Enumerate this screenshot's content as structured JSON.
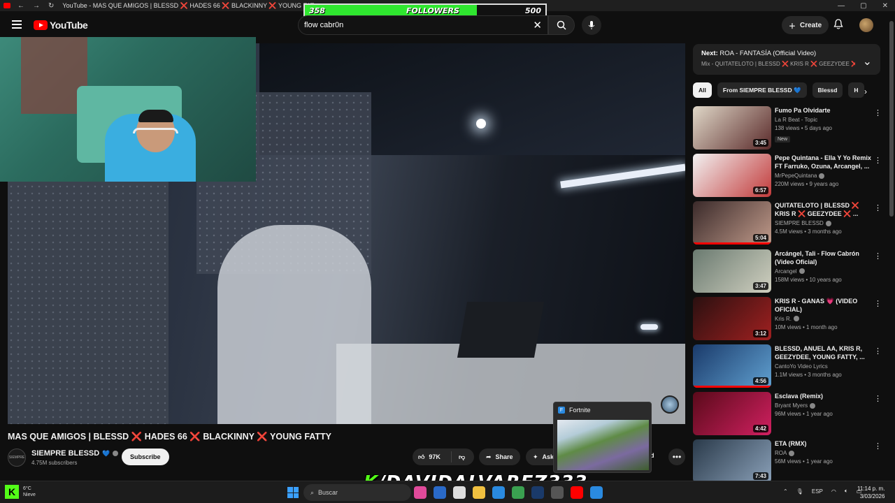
{
  "window": {
    "tab_title": "YouTube - MAS QUE AMIGOS | BLESSD ❌ HADES 66 ❌ BLACKINNY ❌ YOUNG FATTY - YouTube"
  },
  "follower_goal": {
    "current": "358",
    "label": "FOLLOWERS",
    "goal": "500",
    "progress_fraction": 0.716,
    "fill_color": "#2fe62f"
  },
  "header": {
    "logo_text": "YouTube",
    "search_value": "flow cabr0n",
    "create_label": "Create"
  },
  "video": {
    "title": "MAS QUE AMIGOS | BLESSD ❌ HADES 66 ❌ BLACKINNY ❌ YOUNG FATTY",
    "channel_name": "SIEMPRE BLESSD",
    "channel_avatar_text": "SIEMPRE",
    "subscribers": "4.75M subscribers",
    "subscribe_label": "Subscribe",
    "likes": "97K",
    "share_label": "Share",
    "ask_label": "Ask",
    "download_partial": "ad"
  },
  "popup": {
    "icon_letter": "F",
    "title": "Fortnite"
  },
  "sidebar": {
    "next": {
      "prefix": "Next:",
      "title": "ROA - FANTASÍA (Official Video)",
      "subtitle": "Mix - QUITATELOTO | BLESSD ❌ KRIS R ❌ GEEZYDEE ❌ ..."
    },
    "chips": [
      "All",
      "From SIEMPRE BLESSD 💙",
      "Blessd",
      "H"
    ],
    "recommendations": [
      {
        "title": "Fumo Pa Olvidarte",
        "channel": "La R Beat - Topic",
        "views": "138 views • 5 days ago",
        "badge": "New",
        "duration": "3:45",
        "verified": false,
        "progress": 0,
        "colors": [
          "#e0d8c8",
          "#5a2a2a"
        ]
      },
      {
        "title": "Pepe Quintana - Ella Y Yo Remix FT Farruko, Ozuna, Arcangel, ...",
        "channel": "MrPepeQuintana",
        "views": "220M views • 9 years ago",
        "badge": "",
        "duration": "6:57",
        "verified": true,
        "progress": 0,
        "colors": [
          "#f2f2f2",
          "#c23a3a"
        ]
      },
      {
        "title": "QUITATELOTO | BLESSD ❌ KRIS R ❌ GEEZYDEE ❌ ...",
        "channel": "SIEMPRE BLESSD",
        "views": "4.5M views • 3 months ago",
        "badge": "",
        "duration": "5:04",
        "verified": true,
        "progress": 1,
        "colors": [
          "#3a2a2a",
          "#c09a8a"
        ]
      },
      {
        "title": "Arcángel, Tali - Flow Cabrón (Video Oficial)",
        "channel": "Arcangel",
        "views": "158M views • 10 years ago",
        "badge": "",
        "duration": "3:47",
        "verified": true,
        "progress": 0,
        "colors": [
          "#6a7a70",
          "#d0d0c0"
        ]
      },
      {
        "title": "KRIS R - GANAS 💗 (VIDEO OFICIAL)",
        "channel": "Kris R.",
        "views": "10M views • 1 month ago",
        "badge": "",
        "duration": "3:12",
        "verified": true,
        "progress": 0,
        "colors": [
          "#2a1010",
          "#a02020"
        ]
      },
      {
        "title": "BLESSD, ANUEL AA, KRIS R, GEEZYDEE, YOUNG FATTY, ...",
        "channel": "CantoYo Video Lyrics",
        "views": "1.1M views • 3 months ago",
        "badge": "",
        "duration": "4:56",
        "verified": false,
        "progress": 1,
        "colors": [
          "#1a3a6a",
          "#60a0d0"
        ]
      },
      {
        "title": "Esclava (Remix)",
        "channel": "Bryant Myers",
        "views": "96M views • 1 year ago",
        "badge": "",
        "duration": "4:42",
        "verified": true,
        "progress": 0,
        "colors": [
          "#5a0a1a",
          "#d02060"
        ]
      },
      {
        "title": "ETA (RMX)",
        "channel": "ROA",
        "views": "56M views • 1 year ago",
        "badge": "",
        "duration": "7:43",
        "verified": true,
        "progress": 0,
        "colors": [
          "#2a3a4a",
          "#8aa0b8"
        ]
      }
    ]
  },
  "taskbar": {
    "weather_temp": "6°C",
    "weather_desc": "Nieve",
    "search_placeholder": "Buscar",
    "language": "ESP",
    "time": "11:14 p. m.",
    "date": "3/03/2026",
    "kick_handle": "/DAVIDALVAREZ333",
    "kick_letter": "K"
  }
}
